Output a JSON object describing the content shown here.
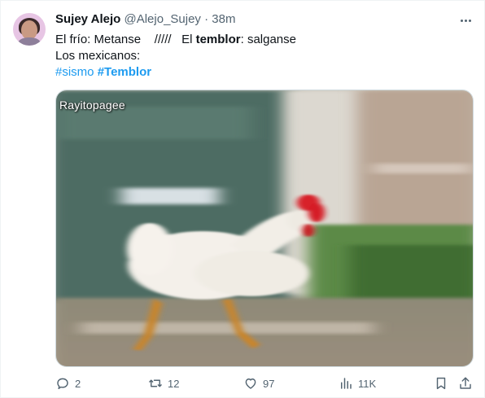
{
  "author": {
    "name": "Sujey Alejo",
    "handle": "@Alejo_Sujey",
    "separator": "·",
    "time": "38m"
  },
  "tweet": {
    "line1_a": "El frío: Metanse",
    "line1_b": "/////",
    "line1_c": "El ",
    "line1_bold": "temblor",
    "line1_d": ": salganse",
    "line2": "Los mexicanos:",
    "hashtag1": "#sismo",
    "hashtag2": "#Temblor"
  },
  "media": {
    "watermark": "Rayitopagee"
  },
  "actions": {
    "replies": "2",
    "reposts": "12",
    "likes": "97",
    "views": "11K"
  },
  "colors": {
    "accent": "#1d9bf0",
    "secondary_text": "#536471",
    "primary_text": "#0f1419"
  },
  "icons": [
    "more-icon",
    "reply-icon",
    "repost-icon",
    "like-icon",
    "views-icon",
    "bookmark-icon",
    "share-icon"
  ]
}
